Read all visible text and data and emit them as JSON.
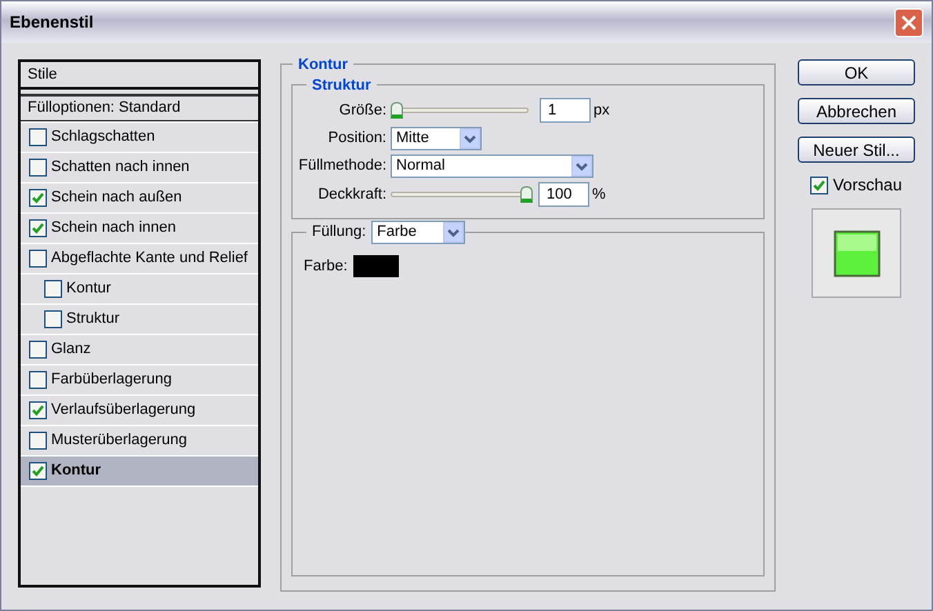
{
  "window": {
    "title": "Ebenenstil"
  },
  "styles_list": {
    "header": "Stile",
    "blending_options": "Fülloptionen: Standard",
    "items": [
      {
        "label": "Schlagschatten",
        "checked": false,
        "selected": false
      },
      {
        "label": "Schatten nach innen",
        "checked": false,
        "selected": false
      },
      {
        "label": "Schein nach außen",
        "checked": true,
        "selected": false
      },
      {
        "label": "Schein nach innen",
        "checked": true,
        "selected": false
      },
      {
        "label": "Abgeflachte Kante und Relief",
        "checked": false,
        "selected": false,
        "children": [
          {
            "label": "Kontur",
            "checked": false,
            "selected": false
          },
          {
            "label": "Struktur",
            "checked": false,
            "selected": false
          }
        ]
      },
      {
        "label": "Glanz",
        "checked": false,
        "selected": false
      },
      {
        "label": "Farbüberlagerung",
        "checked": false,
        "selected": false
      },
      {
        "label": "Verlaufsüberlagerung",
        "checked": true,
        "selected": false
      },
      {
        "label": "Musterüberlagerung",
        "checked": false,
        "selected": false
      },
      {
        "label": "Kontur",
        "checked": true,
        "selected": true
      }
    ]
  },
  "panel": {
    "title": "Kontur",
    "structure": {
      "title": "Struktur",
      "size": {
        "label": "Größe:",
        "level": 0,
        "value": "1",
        "unit": "px"
      },
      "position": {
        "label": "Position:",
        "value": "Mitte"
      },
      "blend_mode": {
        "label": "Füllmethode:",
        "value": "Normal"
      },
      "opacity": {
        "label": "Deckkraft:",
        "level": 1,
        "value": "100",
        "unit": "%"
      }
    },
    "fill": {
      "label": "Füllung:",
      "value": "Farbe",
      "color_label": "Farbe:",
      "color": "#000000"
    }
  },
  "buttons": [
    "OK",
    "Abbrechen",
    "Neuer Stil..."
  ],
  "preview": {
    "label": "Vorschau",
    "checked": true
  }
}
